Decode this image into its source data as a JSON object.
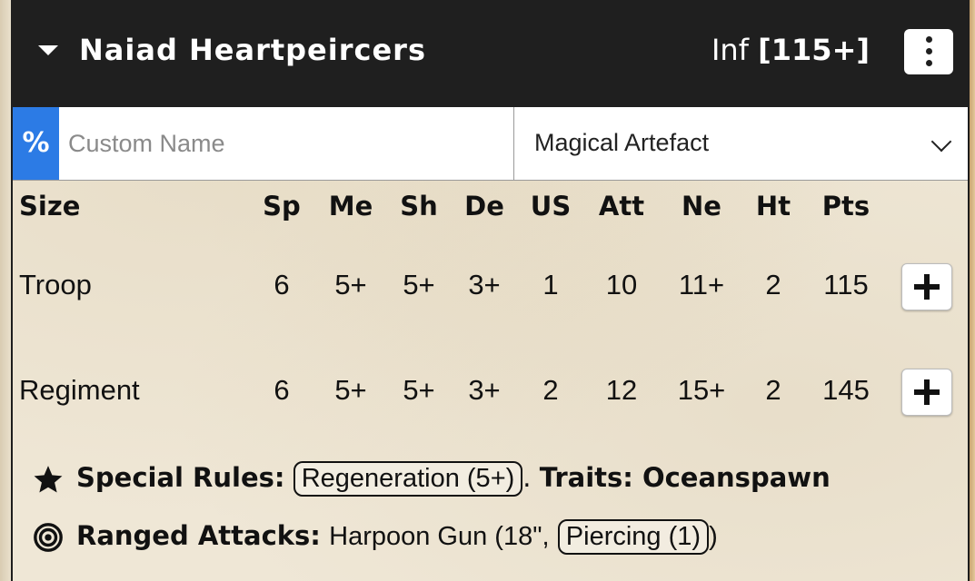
{
  "unit": {
    "name": "Naiad Heartpeircers",
    "type_prefix": "Inf",
    "points_tag": "[115+]"
  },
  "customization": {
    "percent_label": "%",
    "name_placeholder": "Custom Name",
    "artefact_selected": "Magical Artefact"
  },
  "stats": {
    "headers": [
      "Size",
      "Sp",
      "Me",
      "Sh",
      "De",
      "US",
      "Att",
      "Ne",
      "Ht",
      "Pts"
    ],
    "rows": [
      {
        "size": "Troop",
        "sp": "6",
        "me": "5+",
        "sh": "5+",
        "de": "3+",
        "us": "1",
        "att": "10",
        "ne": "11+",
        "ht": "2",
        "pts": "115"
      },
      {
        "size": "Regiment",
        "sp": "6",
        "me": "5+",
        "sh": "5+",
        "de": "3+",
        "us": "2",
        "att": "12",
        "ne": "15+",
        "ht": "2",
        "pts": "145"
      }
    ]
  },
  "special_rules": {
    "label": "Special Rules:",
    "rule": "Regeneration (5+)",
    "separator": ".",
    "traits_label": "Traits: Oceanspawn"
  },
  "ranged": {
    "label": "Ranged Attacks:",
    "weapon": "Harpoon Gun (18\",",
    "keyword": "Piercing (1)",
    "close": ")"
  },
  "icons": {
    "collapse": "caret-down-icon",
    "menu": "vertical-ellipsis-icon",
    "add": "plus-icon",
    "rules": "star-icon",
    "ranged": "target-icon"
  }
}
